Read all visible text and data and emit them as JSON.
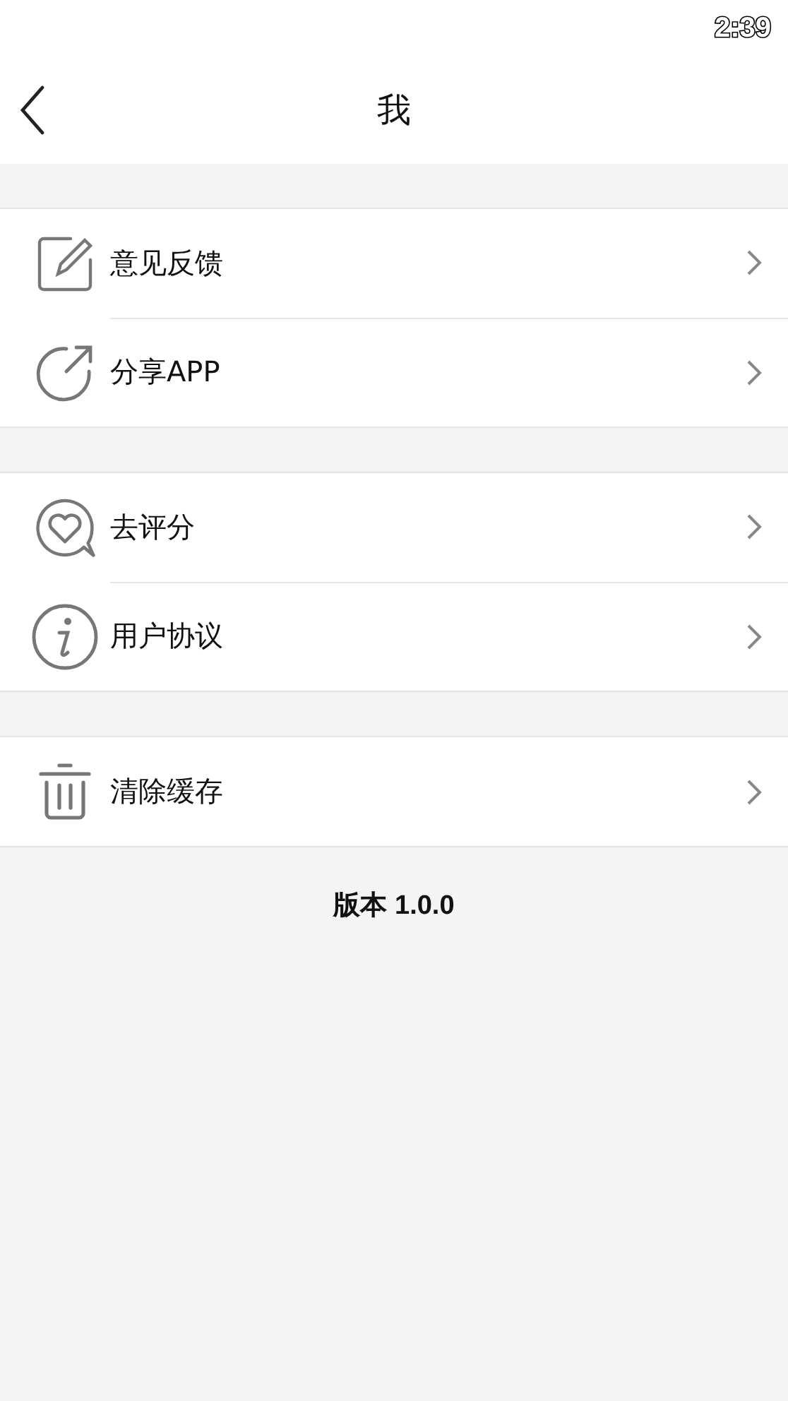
{
  "status_bar": {
    "time": "2:39"
  },
  "nav": {
    "title": "我"
  },
  "groups": [
    {
      "items": [
        {
          "kind": "edit",
          "label": "意见反馈"
        },
        {
          "kind": "share",
          "label": "分享APP"
        }
      ]
    },
    {
      "items": [
        {
          "kind": "rate",
          "label": "去评分"
        },
        {
          "kind": "info",
          "label": "用户协议"
        }
      ]
    },
    {
      "items": [
        {
          "kind": "trash",
          "label": "清除缓存"
        }
      ]
    }
  ],
  "version": "版本 1.0.0"
}
